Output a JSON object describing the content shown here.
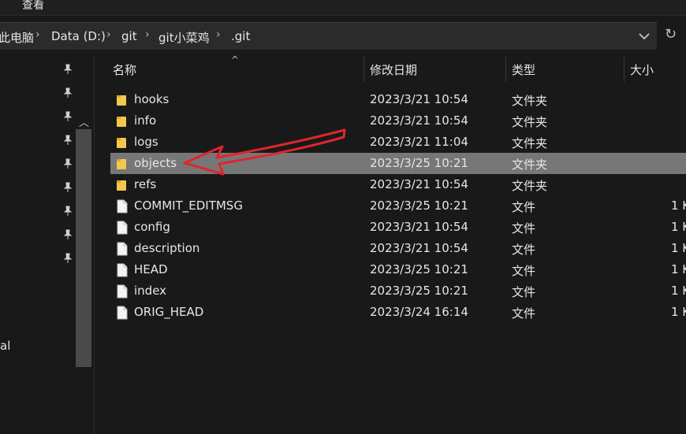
{
  "menubar": {
    "view_label": "查看"
  },
  "addressbar": {
    "crumbs": [
      "此电脑",
      "Data (D:)",
      "git",
      "git小菜鸡",
      ".git"
    ]
  },
  "nav": {
    "partial_label": "al"
  },
  "columns": {
    "name": "名称",
    "date": "修改日期",
    "type": "类型",
    "size": "大小"
  },
  "files": [
    {
      "name": "hooks",
      "date": "2023/3/21 10:54",
      "type": "文件夹",
      "size": "",
      "kind": "folder"
    },
    {
      "name": "info",
      "date": "2023/3/21 10:54",
      "type": "文件夹",
      "size": "",
      "kind": "folder"
    },
    {
      "name": "logs",
      "date": "2023/3/21 11:04",
      "type": "文件夹",
      "size": "",
      "kind": "folder"
    },
    {
      "name": "objects",
      "date": "2023/3/25 10:21",
      "type": "文件夹",
      "size": "",
      "kind": "folder",
      "selected": true
    },
    {
      "name": "refs",
      "date": "2023/3/21 10:54",
      "type": "文件夹",
      "size": "",
      "kind": "folder"
    },
    {
      "name": "COMMIT_EDITMSG",
      "date": "2023/3/25 10:21",
      "type": "文件",
      "size": "1 K",
      "kind": "file"
    },
    {
      "name": "config",
      "date": "2023/3/21 10:54",
      "type": "文件",
      "size": "1 K",
      "kind": "file"
    },
    {
      "name": "description",
      "date": "2023/3/21 10:54",
      "type": "文件",
      "size": "1 K",
      "kind": "file"
    },
    {
      "name": "HEAD",
      "date": "2023/3/25 10:21",
      "type": "文件",
      "size": "1 K",
      "kind": "file"
    },
    {
      "name": "index",
      "date": "2023/3/25 10:21",
      "type": "文件",
      "size": "1 K",
      "kind": "file"
    },
    {
      "name": "ORIG_HEAD",
      "date": "2023/3/24 16:14",
      "type": "文件",
      "size": "1 K",
      "kind": "file"
    }
  ],
  "colors": {
    "background": "#191919",
    "selected_row": "#777777",
    "folder": "#f2c94c",
    "annotation_arrow": "#e0252b"
  }
}
